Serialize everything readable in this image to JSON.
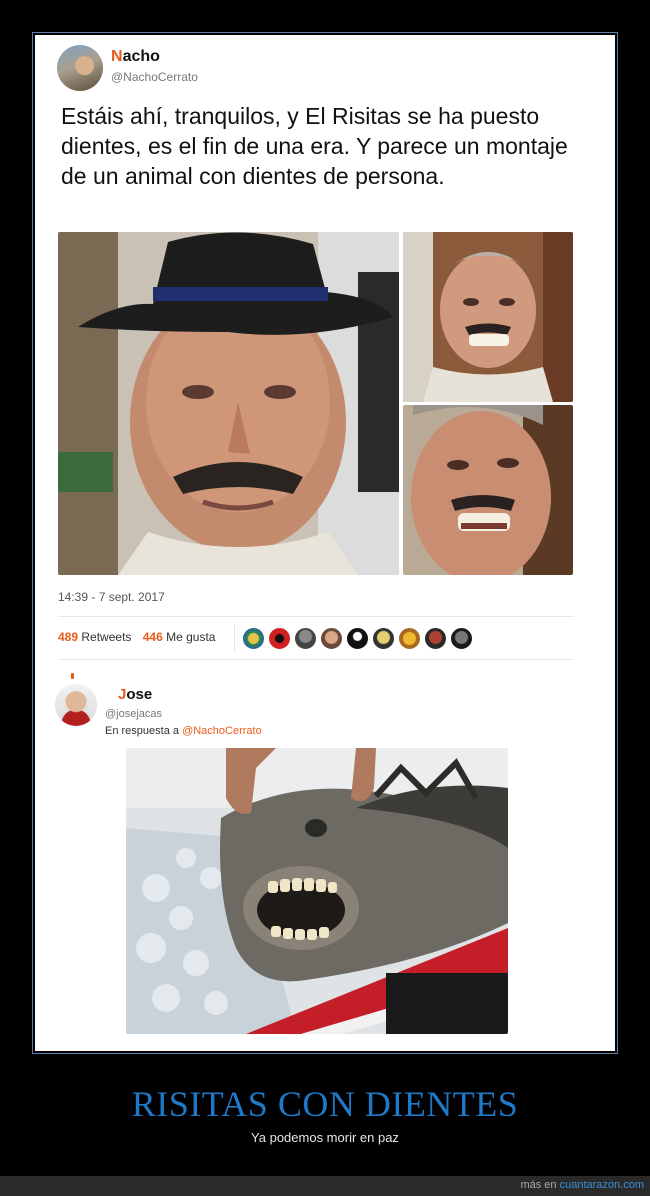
{
  "tweet": {
    "author_initial": "N",
    "author_rest": "acho",
    "handle": "@NachoCerrato",
    "text": "Estáis ahí, tranquilos, y El Risitas se ha puesto dientes, es el fin de una era. Y parece un montaje de un animal con dientes de persona.",
    "timestamp": "14:39 - 7 sept. 2017",
    "retweets_count": "489",
    "retweets_label": "Retweets",
    "likes_count": "446",
    "likes_label": "Me gusta"
  },
  "reply": {
    "author_initial": "J",
    "author_rest": "ose",
    "handle": "@josejacas",
    "reply_prefix": "En respuesta a",
    "reply_target": "@NachoCerrato"
  },
  "poster": {
    "title": "RISITAS CON DIENTES",
    "subtitle": "Ya podemos morir en paz"
  },
  "footer": {
    "prefix": "más en",
    "site": "cuantarazon.com"
  },
  "colors": {
    "accent_orange": "#e85c1b",
    "title_blue": "#1f79c7",
    "frame_blue": "#5b7fa6"
  }
}
